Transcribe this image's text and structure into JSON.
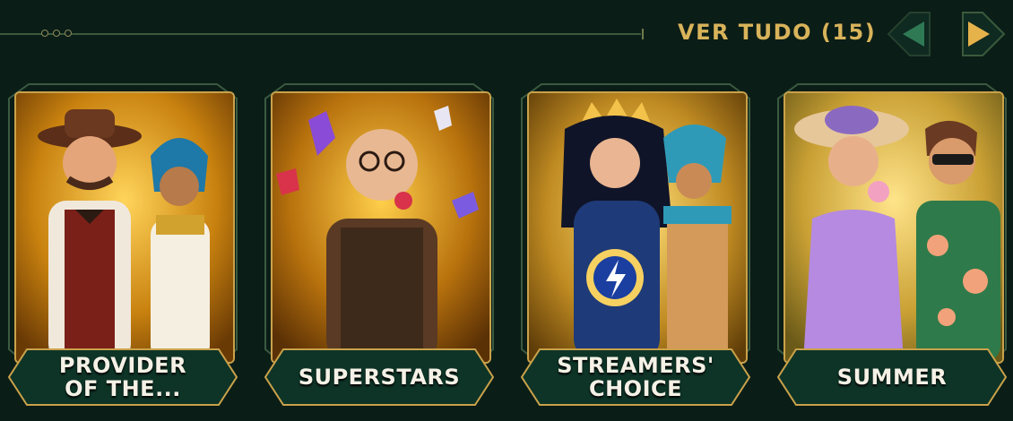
{
  "header": {
    "view_all_label": "VER TUDO (15)",
    "accent_color": "#d8b35a",
    "prev_icon": "triangle-left-icon",
    "next_icon": "triangle-right-icon"
  },
  "categories": [
    {
      "label": "PROVIDER\nOF THE...",
      "theme": "#c98a18"
    },
    {
      "label": "SUPERSTARS",
      "theme": "#b87a12"
    },
    {
      "label": "STREAMERS'\nCHOICE",
      "theme": "#c79a2c"
    },
    {
      "label": "SUMMER",
      "theme": "#c9a034"
    }
  ]
}
